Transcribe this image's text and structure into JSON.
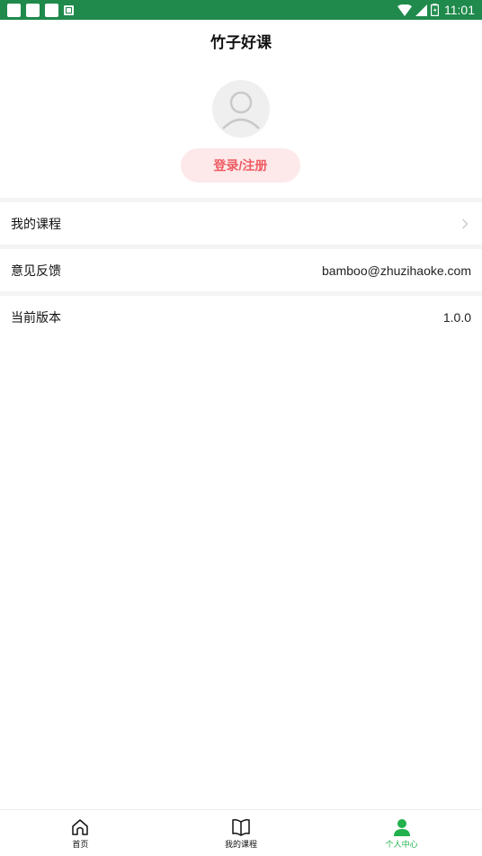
{
  "status_bar": {
    "time": "11:01"
  },
  "header": {
    "title": "竹子好课"
  },
  "profile": {
    "login_label": "登录/注册"
  },
  "menu": {
    "my_courses": {
      "label": "我的课程"
    },
    "feedback": {
      "label": "意见反馈",
      "value": "bamboo@zhuzihaoke.com"
    },
    "version": {
      "label": "当前版本",
      "value": "1.0.0"
    }
  },
  "bottom_nav": {
    "items": [
      {
        "label": "首页",
        "icon": "home-icon"
      },
      {
        "label": "我的课程",
        "icon": "book-icon"
      },
      {
        "label": "个人中心",
        "icon": "person-icon"
      }
    ],
    "active_index": 2
  },
  "colors": {
    "status_bar": "#1f8a4c",
    "accent_red": "#ee5b62",
    "login_bg": "#fde9ea",
    "active_green": "#22b14c"
  }
}
